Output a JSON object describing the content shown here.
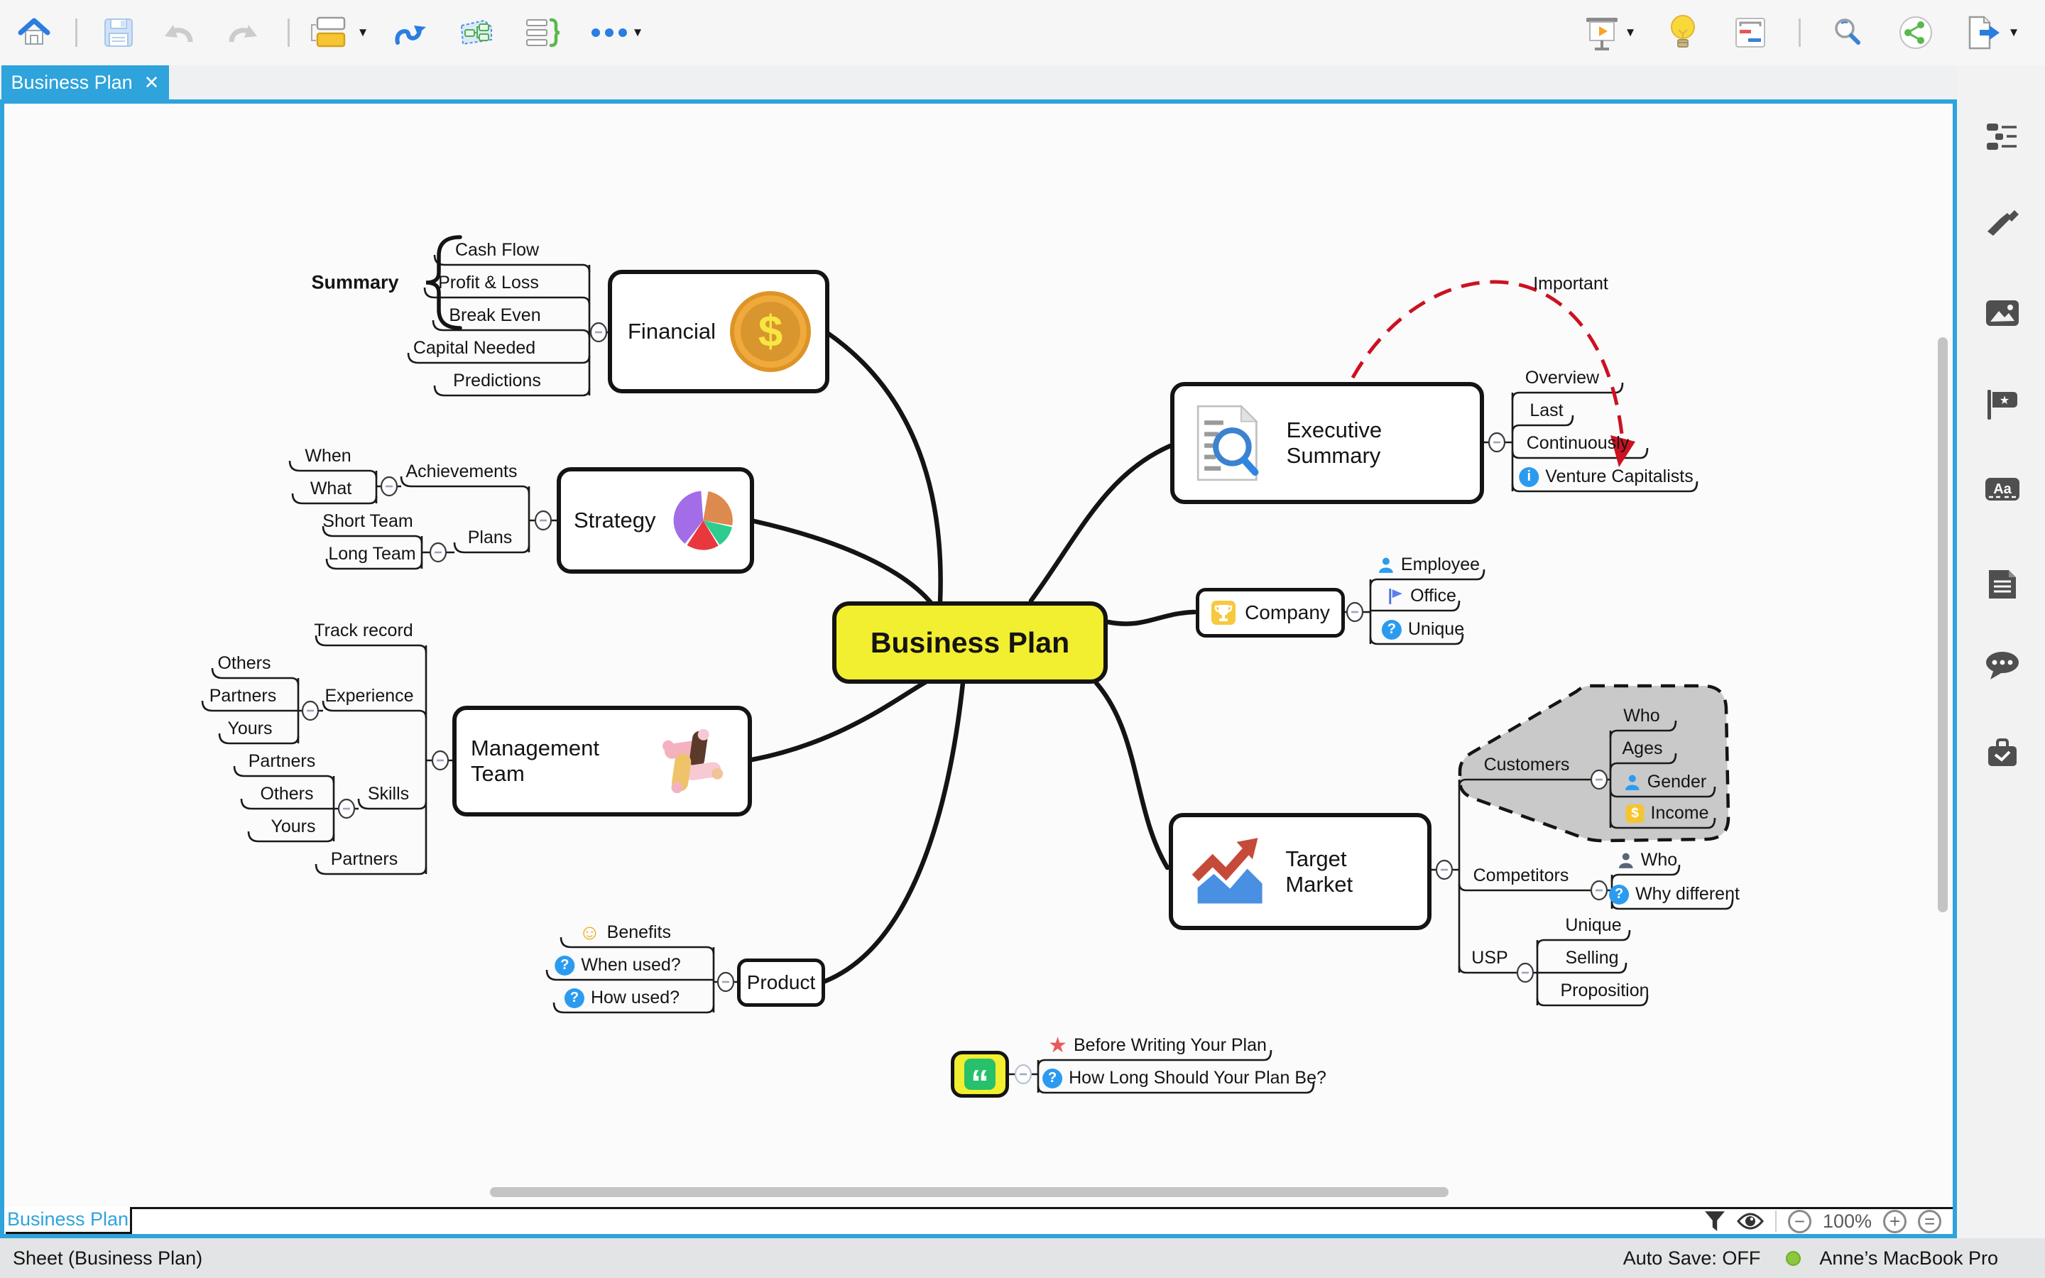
{
  "window": {
    "tab_title": "Business Plan"
  },
  "colors": {
    "accent": "#2ea3dc",
    "center_fill": "#f2ee30",
    "relation_red": "#cc1122",
    "boundary_gray": "#c9c9c9",
    "autosave_dot": "#8dc63f"
  },
  "toolbar": {
    "left_icons": [
      "home",
      "save",
      "undo",
      "redo",
      "node-style",
      "relation",
      "group-border",
      "summary",
      "more"
    ],
    "right_icons": [
      "presentation",
      "idea-bulb",
      "slide-layout",
      "search",
      "share",
      "export"
    ]
  },
  "sidebar": {
    "icons": [
      "topic-tree",
      "style-brush",
      "image",
      "marker-flag",
      "text-label",
      "note",
      "comment",
      "toolbox"
    ]
  },
  "map": {
    "center": "Business Plan",
    "financial": {
      "title": "Financial",
      "summary": "Summary",
      "children": [
        "Cash Flow",
        "Profit & Loss",
        "Break Even",
        "Capital Needed",
        "Predictions"
      ]
    },
    "strategy": {
      "title": "Strategy",
      "achievements": "Achievements",
      "achievements_children": [
        "When",
        "What"
      ],
      "plans": "Plans",
      "plans_children": [
        "Short Team",
        "Long Team"
      ]
    },
    "management": {
      "title": "Management Team",
      "children": [
        "Track record",
        "Experience",
        "Skills",
        "Partners"
      ],
      "experience_children": [
        "Others",
        "Partners",
        "Yours"
      ],
      "skills_children": [
        "Partners",
        "Others",
        "Yours"
      ]
    },
    "product": {
      "title": "Product",
      "children": [
        "Benefits",
        "When used?",
        "How used?"
      ]
    },
    "executive": {
      "title": "Executive Summary",
      "relation": "Important",
      "children": [
        "Overview",
        "Last",
        "Continuously",
        "Venture Capitalists"
      ]
    },
    "company": {
      "title": "Company",
      "children": [
        "Employee",
        "Office",
        "Unique"
      ]
    },
    "target": {
      "title": "Target Market",
      "customers": "Customers",
      "customers_children": [
        "Who",
        "Ages",
        "Gender",
        "Income"
      ],
      "competitors": "Competitors",
      "competitors_children": [
        "Who",
        "Why different"
      ],
      "usp": "USP",
      "usp_children": [
        "Unique",
        "Selling",
        "Proposition"
      ]
    },
    "note": {
      "children": [
        "Before Writing Your Plan",
        "How Long Should Your Plan Be?"
      ]
    }
  },
  "bottom": {
    "sheet_tab": "Business Plan",
    "zoom_level": "100%"
  },
  "status": {
    "left": "Sheet (Business Plan)",
    "autosave": "Auto Save: OFF",
    "device": "Anne’s MacBook Pro"
  }
}
